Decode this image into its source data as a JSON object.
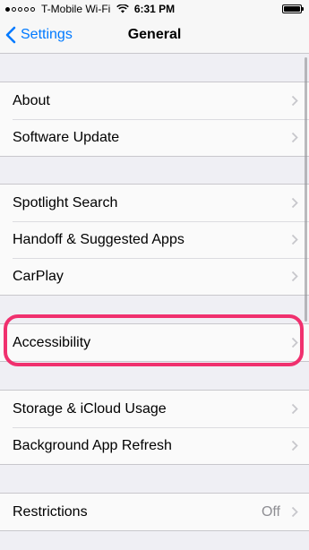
{
  "status_bar": {
    "carrier": "T-Mobile Wi-Fi",
    "time": "6:31 PM"
  },
  "nav": {
    "back_label": "Settings",
    "title": "General"
  },
  "groups": [
    {
      "rows": [
        {
          "label": "About"
        },
        {
          "label": "Software Update"
        }
      ]
    },
    {
      "rows": [
        {
          "label": "Spotlight Search"
        },
        {
          "label": "Handoff & Suggested Apps"
        },
        {
          "label": "CarPlay"
        }
      ]
    },
    {
      "rows": [
        {
          "label": "Accessibility"
        }
      ]
    },
    {
      "rows": [
        {
          "label": "Storage & iCloud Usage"
        },
        {
          "label": "Background App Refresh"
        }
      ]
    },
    {
      "rows": [
        {
          "label": "Restrictions",
          "value": "Off"
        }
      ]
    }
  ],
  "icons": {
    "back": "chevron-left-icon",
    "row_disclosure": "chevron-right-icon",
    "wifi": "wifi-icon",
    "battery": "battery-icon"
  },
  "colors": {
    "accent": "#007aff",
    "highlight": "#f0306e",
    "background": "#efeff4",
    "cell": "#fafafa"
  }
}
